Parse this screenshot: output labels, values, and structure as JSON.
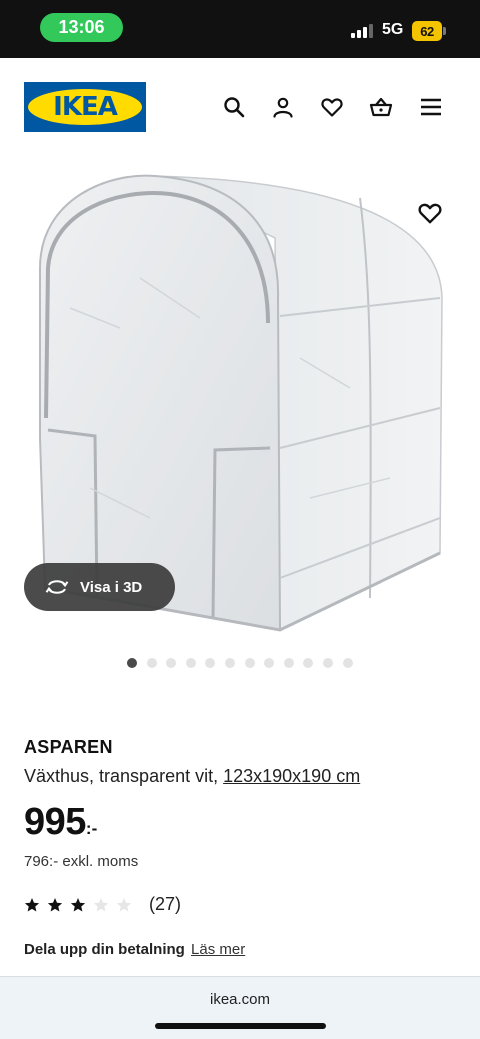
{
  "status_bar": {
    "time": "13:06",
    "network": "5G",
    "battery": "62"
  },
  "header": {
    "logo_text": "IKEA",
    "icons": [
      "search-icon",
      "account-icon",
      "favorites-icon",
      "cart-icon",
      "menu-icon"
    ]
  },
  "gallery": {
    "view_3d_label": "Visa i 3D",
    "image_count": 12,
    "active_index": 0
  },
  "product": {
    "name": "ASPAREN",
    "description": "Växthus, transparent vit, ",
    "size": "123x190x190 cm",
    "price": "995",
    "price_suffix": ":-",
    "price_ex_vat": "796:- exkl. moms",
    "rating_stars": 3,
    "rating_max": 5,
    "review_count": "(27)",
    "payment_title": "Dela upp din betalning",
    "payment_link": "Läs mer"
  },
  "browser": {
    "url": "ikea.com"
  },
  "colors": {
    "brand_blue": "#0058a3",
    "brand_yellow": "#ffdb00",
    "status_green": "#32c85a"
  }
}
